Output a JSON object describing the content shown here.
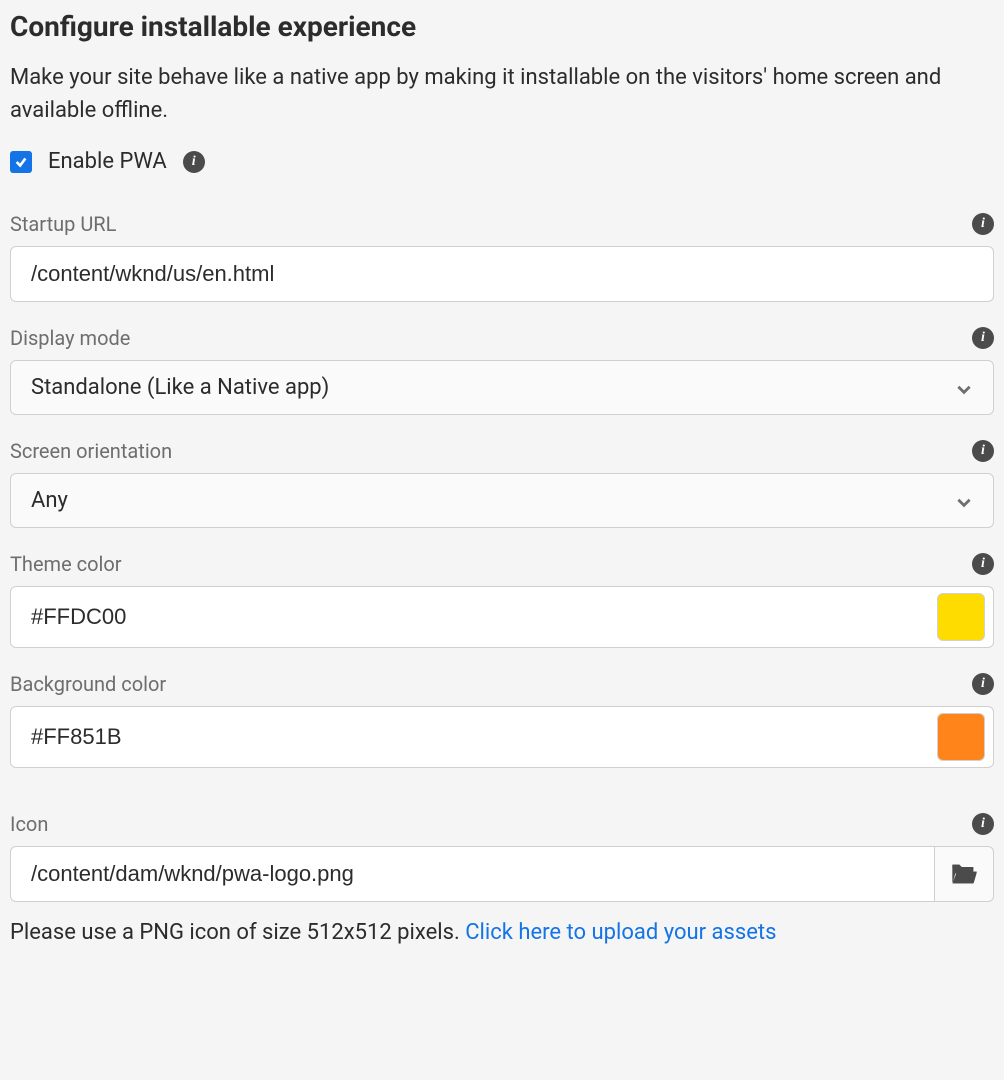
{
  "header": {
    "title": "Configure installable experience",
    "description": "Make your site behave like a native app by making it installable on the visitors' home screen and available offline."
  },
  "enable": {
    "label": "Enable PWA",
    "checked": true
  },
  "fields": {
    "startupUrl": {
      "label": "Startup URL",
      "value": "/content/wknd/us/en.html"
    },
    "displayMode": {
      "label": "Display mode",
      "value": "Standalone (Like a Native app)"
    },
    "screenOrientation": {
      "label": "Screen orientation",
      "value": "Any"
    },
    "themeColor": {
      "label": "Theme color",
      "value": "#FFDC00",
      "swatch": "#FFDC00"
    },
    "backgroundColor": {
      "label": "Background color",
      "value": "#FF851B",
      "swatch": "#FF851B"
    },
    "icon": {
      "label": "Icon",
      "value": "/content/dam/wknd/pwa-logo.png",
      "hint": "Please use a PNG icon of size 512x512 pixels. ",
      "link": "Click here to upload your assets"
    }
  }
}
